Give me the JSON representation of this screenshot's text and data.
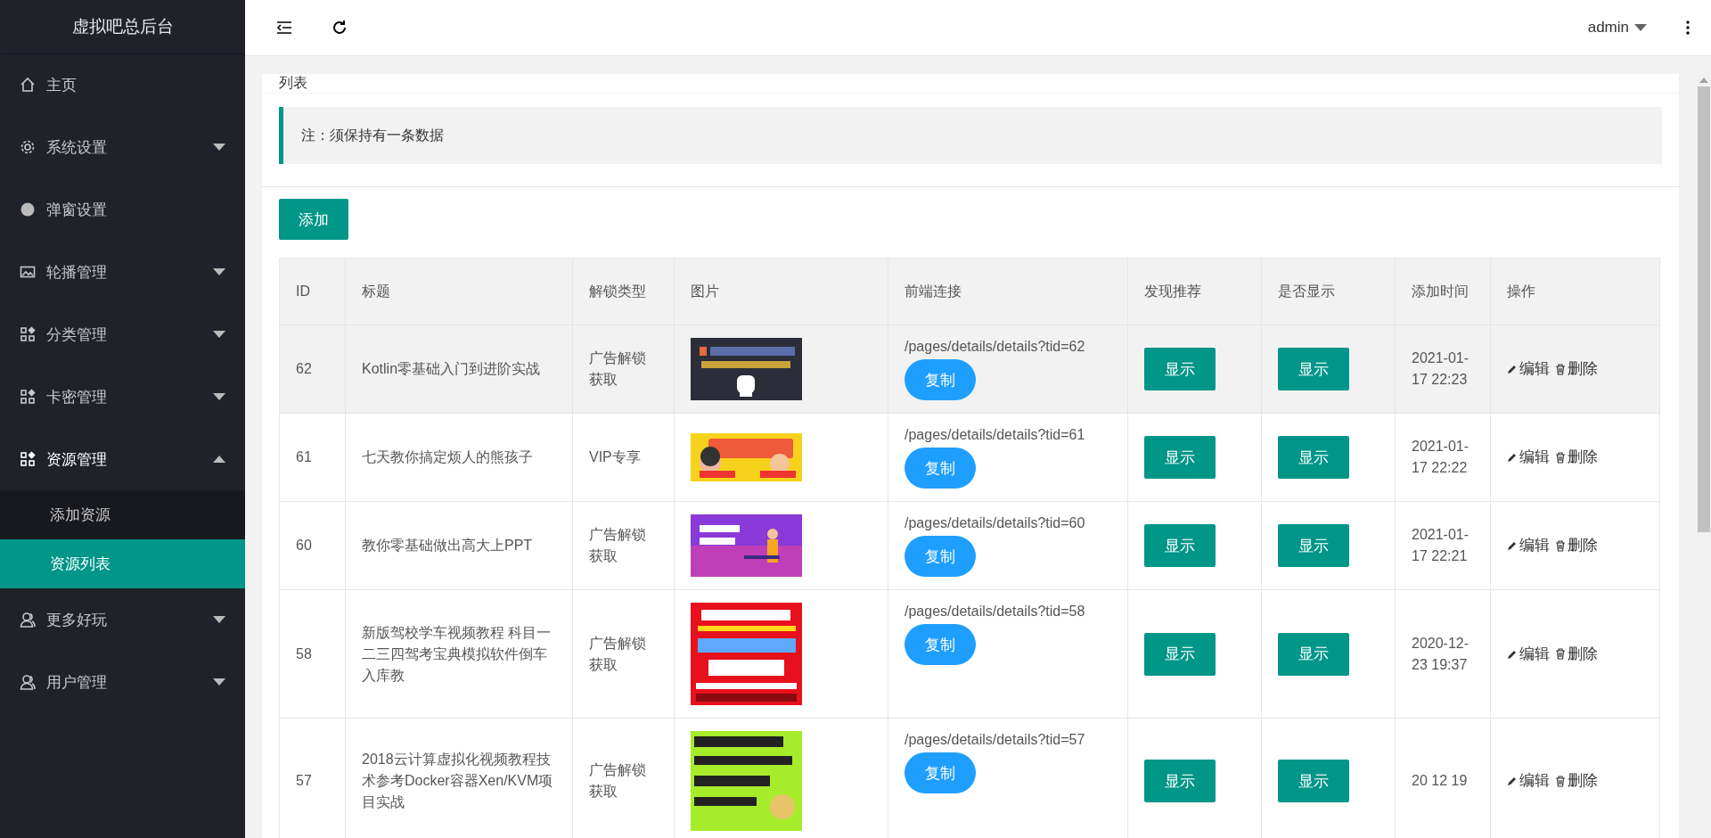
{
  "sidebar": {
    "title": "虚拟吧总后台",
    "items": [
      {
        "label": "主页"
      },
      {
        "label": "系统设置",
        "expanded": false
      },
      {
        "label": "弹窗设置"
      },
      {
        "label": "轮播管理",
        "expanded": false
      },
      {
        "label": "分类管理",
        "expanded": false
      },
      {
        "label": "卡密管理",
        "expanded": false
      },
      {
        "label": "资源管理",
        "expanded": true,
        "children": [
          {
            "label": "添加资源",
            "selected": false
          },
          {
            "label": "资源列表",
            "selected": true
          }
        ]
      },
      {
        "label": "更多好玩",
        "expanded": false
      },
      {
        "label": "用户管理",
        "expanded": false
      }
    ]
  },
  "header": {
    "user": "admin"
  },
  "card": {
    "title": "列表",
    "note": "注：须保持有一条数据",
    "add_button": "添加",
    "table": {
      "columns": [
        "ID",
        "标题",
        "解锁类型",
        "图片",
        "前端连接",
        "发现推荐",
        "是否显示",
        "添加时间",
        "操作"
      ],
      "rows": [
        {
          "selected": true,
          "id": "62",
          "title": "Kotlin零基础入门到进阶实战",
          "unlock": "广告解锁获取",
          "link": "/pages/details/details?tid=62",
          "copy": "复制",
          "recommend": "显示",
          "show": "显示",
          "time": "2021-01-17 22:23",
          "edit": "编辑",
          "delete": "删除"
        },
        {
          "selected": false,
          "id": "61",
          "title": "七天教你搞定烦人的熊孩子",
          "unlock": "VIP专享",
          "link": "/pages/details/details?tid=61",
          "copy": "复制",
          "recommend": "显示",
          "show": "显示",
          "time": "2021-01-17 22:22",
          "edit": "编辑",
          "delete": "删除"
        },
        {
          "selected": false,
          "id": "60",
          "title": "教你零基础做出高大上PPT",
          "unlock": "广告解锁获取",
          "link": "/pages/details/details?tid=60",
          "copy": "复制",
          "recommend": "显示",
          "show": "显示",
          "time": "2021-01-17 22:21",
          "edit": "编辑",
          "delete": "删除"
        },
        {
          "selected": false,
          "id": "58",
          "title": "新版驾校学车视频教程 科目一二三四驾考宝典模拟软件倒车入库教",
          "unlock": "广告解锁获取",
          "link": "/pages/details/details?tid=58",
          "copy": "复制",
          "recommend": "显示",
          "show": "显示",
          "time": "2020-12-23 19:37",
          "edit": "编辑",
          "delete": "删除"
        },
        {
          "selected": false,
          "id": "57",
          "title": "2018云计算虚拟化视频教程技术参考Docker容器Xen/KVM项目实战",
          "unlock": "广告解锁获取",
          "link": "/pages/details/details?tid=57",
          "copy": "复制",
          "recommend": "显示",
          "show": "显示",
          "time": "20 12 19",
          "edit": "编辑",
          "delete": "删除"
        }
      ]
    }
  }
}
